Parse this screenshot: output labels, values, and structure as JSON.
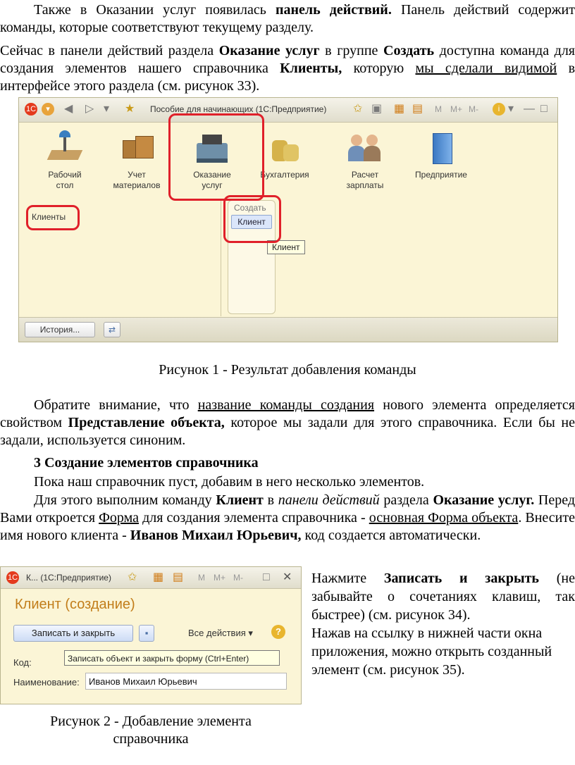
{
  "para1": {
    "t1": "Также в Оказании услуг появилась ",
    "b1": "панель действий.",
    "t2": " Панель действий содержит команды, которые соответствуют текущему разделу."
  },
  "para2": {
    "t1": "Сейчас в панели действий раздела ",
    "b1": "Оказание услуг",
    "t2": " в группе ",
    "b2": "Создать",
    "t3": " доступна команда для создания элементов нашего справочника ",
    "b3": "Клиенты,",
    "t4": " которую ",
    "u1": "мы сделали видимой",
    "t5": " в интерфейсе этого раздела (см. рисунок 33)."
  },
  "figure1": {
    "window_title": "Пособие для начинающих  (1С:Предприятие)",
    "toolbar_labels": [
      "M",
      "M+",
      "M-"
    ],
    "sections": [
      {
        "line1": "Рабочий",
        "line2": "стол"
      },
      {
        "line1": "Учет",
        "line2": "материалов"
      },
      {
        "line1": "Оказание",
        "line2": "услуг"
      },
      {
        "line1": "Бухгалтерия",
        "line2": ""
      },
      {
        "line1": "Расчет",
        "line2": "зарплаты"
      },
      {
        "line1": "Предприятие",
        "line2": ""
      }
    ],
    "nav_item": "Клиенты",
    "group_label": "Создать",
    "command": "Клиент",
    "tooltip": "Клиент",
    "history_button": "История...",
    "caption": "Рисунок 1 - Результат добавления команды"
  },
  "para3": {
    "t1": "Обратите внимание, что ",
    "u1": "название команды создания",
    "t2": " нового элемента определяется свойством ",
    "b1": "Представление объекта,",
    "t3": " которое мы задали для этого справочника. Если бы не задали, используется синоним."
  },
  "heading": "3 Создание элементов справочника",
  "para4": "Пока наш справочник пуст, добавим в него несколько элементов.",
  "para5": {
    "t1": "Для этого выполним команду ",
    "b1": "Клиент",
    "t2": " в ",
    "i1": "панели действий",
    "t3": " раздела ",
    "b2": "Оказание услуг.",
    "t4": " Перед Вами откроется ",
    "u1": "Форма",
    "t5": " для создания элемента справочника - ",
    "u2": "основная Форма объекта",
    "t6": ". Внесите имя нового клиента - ",
    "b3": "Иванов Михаил Юрьевич,",
    "t7": " код создается автоматически."
  },
  "side_text": {
    "t1": "Нажмите ",
    "b1": "Записать и закрыть",
    "t2": " (не забывайте о сочетаниях клавиш, так быстрее) (см. рисунок 34).",
    "t3": "Нажав на ссылку в нижней части окна приложения, можно открыть созданный элемент (см. рисунок 35)."
  },
  "figure2": {
    "window_title": "К...  (1С:Предприятие)",
    "toolbar_labels": [
      "M",
      "M+",
      "M-"
    ],
    "form_title": "Клиент (создание)",
    "save_close_button": "Записать и закрыть",
    "all_actions": "Все действия ▾",
    "help": "?",
    "code_label": "Код:",
    "tooltip": "Записать объект и закрыть форму (Ctrl+Enter)",
    "name_label": "Наименование:",
    "name_value": "Иванов Михаил Юрьевич",
    "caption_line1": "Рисунок 2 - Добавление элемента",
    "caption_line2": "справочника"
  },
  "colors": {
    "highlight_red": "#e0202a",
    "window_bg": "#fbf5d6",
    "form_title": "#c27d1a"
  }
}
